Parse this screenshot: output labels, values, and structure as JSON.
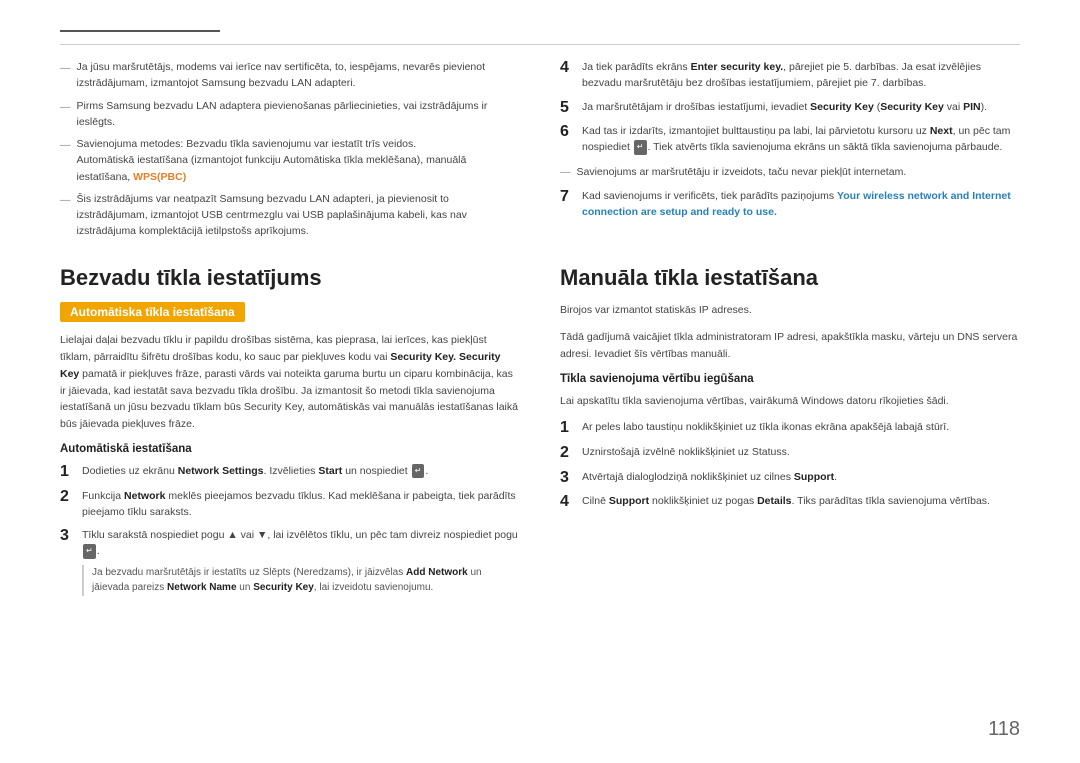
{
  "page": {
    "number": "118"
  },
  "top_section": {
    "left_bullets": [
      "Ja jūsu maršrutētājs, modems vai ierīce nav sertificēta, to, iespējams, nevarēs pievienot izstrādājumam, izmantojot Samsung bezvadu LAN adapteri.",
      "Pirms Samsung bezvadu LAN adaptera pievienošanas pārliecinieties, vai izstrādājums ir ieslēgts.",
      "Savienojuma metodes: Bezvadu tīkla savienojumu var iestatīt trīs veidos. Automātiskā iestatīšana (izmantojot funkciju Automātiska tīkla meklēšana), manuālā iestatīšana, WPS(PBC)",
      "Šis izstrādājums var neatpazīt Samsung bezvadu LAN adapteri, ja pievienosit to izstrādājumam, izmantojot USB centrmezglu vai USB paplašinājuma kabeli, kas nav izstrādājuma komplektācijā ietilpstošs aprīkojums."
    ],
    "right_items": [
      {
        "num": "4",
        "text": "Ja tiek parādīts ekrāns Enter security key., pārejiet pie 5. darbības. Ja esat izvēlējies bezvadu maršrutētāju bez drošības iestatījumiem, pārejiet pie 7. darbības."
      },
      {
        "num": "5",
        "text": "Ja maršrutētājam ir drošības iestatījumi, ievadiet Security Key (Security Key vai PIN)."
      },
      {
        "num": "6",
        "text": "Kad tas ir izdarīts, izmantojiet bulttaustiņu pa labi, lai pārvietotu kursoru uz Next, un pēc tam nospiediet [icon]. Tiek atvērts tīkla savienojuma ekrāns un sāktā tīkla savienojuma pārbaude."
      },
      {
        "note": "Savienojums ar maršrutētāju ir izveidots, taču nevar piekļūt internetam."
      },
      {
        "num": "7",
        "text_bold_green": "Your wireless network and Internet connection are setup and ready to use.",
        "text_prefix": "Kad savienojums ir verificēts, tiek parādīts paziņojums "
      }
    ]
  },
  "left_section": {
    "title": "Bezvadu tīkla iestatījums",
    "badge": "Automātiska tīkla iestatīšana",
    "body": "Lielajai daļai bezvadu tīklu ir papildu drošības sistēma, kas pieprasa, lai ierīces, kas piekļūst tīklam, pārraidītu šifrētu drošības kodu, ko sauc par piekļuves kodu vai Security Key. Security Key pamatā ir piekļuves frāze, parasti vārds vai noteikta garuma burtu un ciparu kombinācija, kas ir jāievada, kad iestatāt sava bezvadu tīkla drošību. Ja izmantosit šo metodi tīkla savienojuma iestatīšanā un jūsu bezvadu tīklam būs Security Key, automātiskās vai manuālās iestatīšanas laikā būs jāievada piekļuves frāze.",
    "sub_heading": "Automātiskā iestatīšana",
    "steps": [
      {
        "num": "1",
        "text": "Dodieties uz ekrānu Network Settings. Izvēlieties Start un nospiediet [icon]."
      },
      {
        "num": "2",
        "text": "Funkcija Network meklēs pieejamos bezvadu tīklus. Kad meklēšana ir pabeigta, tiek parādīts pieejamo tīklu saraksts."
      },
      {
        "num": "3",
        "text": "Tīklu sarakstā nospiediet pogu ▲ vai ▼, lai izvēlētos tīklu, un pēc tam divreiz nospiediet pogu [icon].",
        "sub_bullet": "Ja bezvadu maršrutētājs ir iestatīts uz Slēpts (Neredzams), ir jāizvēlas Add Network un jāievada pareizs Network Name un Security Key, lai izveidotu savienojumu."
      }
    ]
  },
  "right_section": {
    "title": "Manuāla tīkla iestatīšana",
    "body1": "Birojos var izmantot statiskās IP adreses.",
    "body2": "Tādā gadījumā vaicājiet tīkla administratoram IP adresi, apakštīkla masku, vārteju un DNS servera adresi. Ievadiet šīs vērtības manuāli.",
    "sub_heading": "Tīkla savienojuma vērtību iegūšana",
    "body3": "Lai apskatītu tīkla savienojuma vērtības, vairākumā Windows datoru rīkojieties šādi.",
    "steps": [
      {
        "num": "1",
        "text": "Ar peles labo taustiņu noklikšķiniet uz tīkla ikonas ekrāna apakšējā labajā stūrī."
      },
      {
        "num": "2",
        "text": "Uznirstošajā izvēlnē noklikšķiniet uz Statuss."
      },
      {
        "num": "3",
        "text": "Atvērtajā dialoglodziņā noklikšķiniet uz cilnes Support."
      },
      {
        "num": "4",
        "text": "Cilnē Support noklikšķiniet uz pogas Details. Tiks parādītas tīkla savienojuma vērtības."
      }
    ]
  }
}
